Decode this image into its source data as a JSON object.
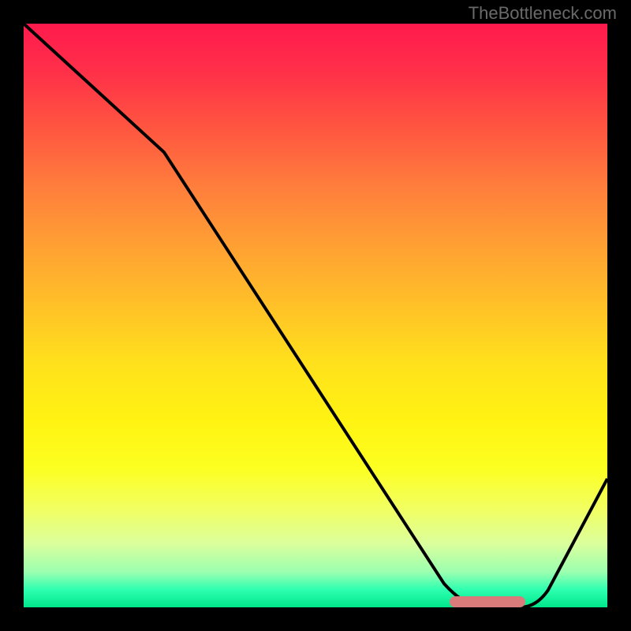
{
  "watermark": "TheBottleneck.com",
  "chart_data": {
    "type": "line",
    "title": "",
    "xlabel": "",
    "ylabel": "",
    "xlim": [
      0,
      100
    ],
    "ylim": [
      0,
      100
    ],
    "grid": false,
    "background": "gradient-red-to-green-vertical",
    "series": [
      {
        "name": "bottleneck-curve",
        "x": [
          0,
          24,
          72,
          79,
          85,
          100
        ],
        "values": [
          100,
          78,
          4,
          0,
          0,
          22
        ]
      }
    ],
    "annotations": [
      {
        "name": "optimal-range-marker",
        "type": "rounded-bar",
        "x_start": 73,
        "x_end": 86,
        "y": 0.5,
        "color": "#d97b7b"
      }
    ],
    "gradient_stops": [
      {
        "pos": 0,
        "color": "#ff1a4d"
      },
      {
        "pos": 8,
        "color": "#ff2f49"
      },
      {
        "pos": 18,
        "color": "#ff5640"
      },
      {
        "pos": 28,
        "color": "#ff7e3c"
      },
      {
        "pos": 38,
        "color": "#ffa033"
      },
      {
        "pos": 48,
        "color": "#ffc028"
      },
      {
        "pos": 58,
        "color": "#ffe01c"
      },
      {
        "pos": 68,
        "color": "#fff312"
      },
      {
        "pos": 76,
        "color": "#fcff20"
      },
      {
        "pos": 83,
        "color": "#f2ff60"
      },
      {
        "pos": 89,
        "color": "#dcff9c"
      },
      {
        "pos": 94,
        "color": "#9affb0"
      },
      {
        "pos": 97,
        "color": "#2dffb0"
      },
      {
        "pos": 100,
        "color": "#00e68a"
      }
    ]
  },
  "colors": {
    "page_bg": "#000000",
    "curve": "#000000",
    "marker": "#d97b7b",
    "watermark": "#6a6a6a"
  }
}
